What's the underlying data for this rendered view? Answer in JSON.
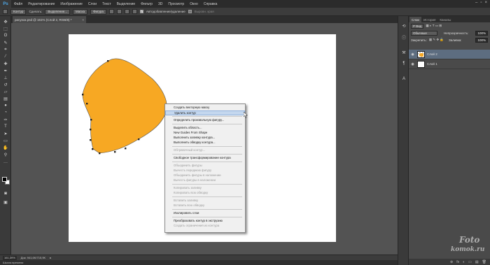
{
  "menubar": {
    "logo": "Ps",
    "items": [
      "Файл",
      "Редактирование",
      "Изображение",
      "Слои",
      "Текст",
      "Выделение",
      "Фильтр",
      "3D",
      "Просмотр",
      "Окно",
      "Справка"
    ],
    "controls": [
      "–",
      "▫",
      "×"
    ]
  },
  "options": {
    "tool_mode": "Контур",
    "make_label": "Сделать:",
    "selection_btn": "Выделение...",
    "mask_btn": "Маска",
    "shape_btn": "Фигура",
    "autoadd_label": "Автодобавление/удаление",
    "align_edges_label": "Выровн. края"
  },
  "document": {
    "tab_title": "рисунок.psd @ 161% (Слой 2, RGB/8) *",
    "tab_close": "×",
    "shape_color": "#f7a823"
  },
  "status": {
    "zoom": "161,39%",
    "doc_size": "Док: 941,6K/715,9K",
    "timeline": "Шкала времени"
  },
  "context_menu": {
    "items": [
      {
        "label": "Создать векторную маску",
        "state": "normal"
      },
      {
        "label": "Удалить контур",
        "state": "highlighted"
      },
      {
        "sep": true
      },
      {
        "label": "Определить произвольную фигуру...",
        "state": "normal"
      },
      {
        "sep": true
      },
      {
        "label": "Выделить область...",
        "state": "normal"
      },
      {
        "label": "New Guides From Shape",
        "state": "normal"
      },
      {
        "label": "Выполнить заливку контура...",
        "state": "normal"
      },
      {
        "label": "Выполнить обводку контура...",
        "state": "normal"
      },
      {
        "sep": true
      },
      {
        "label": "Обтравочный контур...",
        "state": "disabled"
      },
      {
        "sep": true
      },
      {
        "label": "Свободное трансформирование контура",
        "state": "normal"
      },
      {
        "sep": true
      },
      {
        "label": "Объединить фигуры",
        "state": "disabled"
      },
      {
        "label": "Вычесть переднюю фигуру",
        "state": "disabled"
      },
      {
        "label": "Объединить фигуры в наложении",
        "state": "disabled"
      },
      {
        "label": "Вычесть фигуры в наложении",
        "state": "disabled"
      },
      {
        "sep": true
      },
      {
        "label": "Копировать заливку",
        "state": "disabled"
      },
      {
        "label": "Копировать всю обводку",
        "state": "disabled"
      },
      {
        "sep": true
      },
      {
        "label": "Вставить заливку",
        "state": "disabled"
      },
      {
        "label": "Вставить всю обводку",
        "state": "disabled"
      },
      {
        "sep": true
      },
      {
        "label": "Изолировать слои",
        "state": "normal"
      },
      {
        "sep": true
      },
      {
        "label": "Преобразовать контур в экструзию",
        "state": "normal"
      },
      {
        "label": "Создать ограничения из контура",
        "state": "disabled"
      }
    ]
  },
  "layers_panel": {
    "tabs": [
      "Слои",
      "История",
      "Каналы"
    ],
    "filter_label": "Р Вид",
    "blend_mode": "Обычные",
    "opacity_label": "Непрозрачность:",
    "opacity_value": "100%",
    "lock_label": "Закрепить:",
    "fill_label": "Заливка:",
    "fill_value": "100%",
    "layers": [
      {
        "name": "Слой 2",
        "selected": true,
        "visible": true
      },
      {
        "name": "Слой 1",
        "selected": false,
        "visible": true
      }
    ],
    "footer_icons": [
      "⊕",
      "fx",
      "◐",
      "▭",
      "▤",
      "🗑"
    ]
  },
  "watermark": {
    "line1": "Foto",
    "line2": "komok.ru"
  }
}
